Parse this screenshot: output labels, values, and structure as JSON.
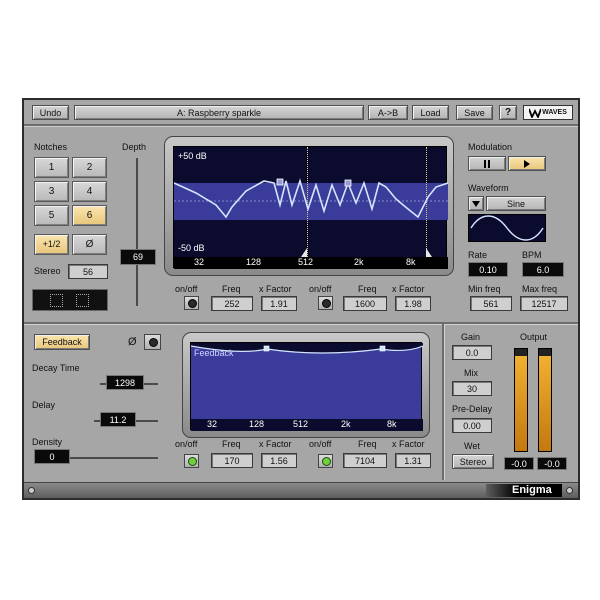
{
  "toolbar": {
    "undo": "Undo",
    "preset": "A: Raspberry sparkle",
    "ab": "A->B",
    "load": "Load",
    "save": "Save",
    "help": "?",
    "brand": "WAVES"
  },
  "notches": {
    "label": "Notches",
    "buttons": [
      "1",
      "2",
      "3",
      "4",
      "5",
      "6"
    ],
    "selected": "6",
    "half": "+1/2",
    "phase": "Ø",
    "stereo_label": "Stereo",
    "stereo_value": "56"
  },
  "depth": {
    "label": "Depth",
    "value": "69"
  },
  "display1": {
    "top_db": "+50 dB",
    "bottom_db": "-50 dB",
    "freq_ticks": [
      "32",
      "128",
      "512",
      "2k",
      "8k"
    ]
  },
  "filter1": {
    "band1": {
      "onoff": "on/off",
      "freq_label": "Freq",
      "freq": "252",
      "xf_label": "x Factor",
      "xf": "1.91"
    },
    "band2": {
      "onoff": "on/off",
      "freq_label": "Freq",
      "freq": "1600",
      "xf_label": "x Factor",
      "xf": "1.98"
    }
  },
  "modulation": {
    "label": "Modulation",
    "waveform_label": "Waveform",
    "waveform": "Sine",
    "rate_label": "Rate",
    "rate": "0.10",
    "bpm_label": "BPM",
    "bpm": "6.0",
    "minfreq_label": "Min freq",
    "minfreq": "561",
    "maxfreq_label": "Max freq",
    "maxfreq": "12517"
  },
  "feedback": {
    "button": "Feedback",
    "phase": "Ø",
    "decay_label": "Decay Time",
    "decay": "1298",
    "delay_label": "Delay",
    "delay": "11.2",
    "density_label": "Density",
    "density": "0",
    "display_label": "Feedback",
    "freq_ticks": [
      "32",
      "128",
      "512",
      "2k",
      "8k"
    ],
    "band1": {
      "onoff": "on/off",
      "freq_label": "Freq",
      "freq": "170",
      "xf_label": "x Factor",
      "xf": "1.56"
    },
    "band2": {
      "onoff": "on/off",
      "freq_label": "Freq",
      "freq": "7104",
      "xf_label": "x Factor",
      "xf": "1.31"
    }
  },
  "output": {
    "gain_label": "Gain",
    "gain": "0.0",
    "mix_label": "Mix",
    "mix": "30",
    "predelay_label": "Pre-Delay",
    "predelay": "0.00",
    "wet_label": "Wet",
    "wet": "Stereo",
    "output_label": "Output",
    "meter_left": "-0.0",
    "meter_right": "-0.0",
    "meter_level": 0.93
  },
  "footer": {
    "name": "Enigma"
  },
  "colors": {
    "panel": "#a6a6a6",
    "display_bg": "#0b0b2e",
    "band": "#3b3b9a",
    "highlight": "#f0c870",
    "meter": "#e5a020"
  }
}
